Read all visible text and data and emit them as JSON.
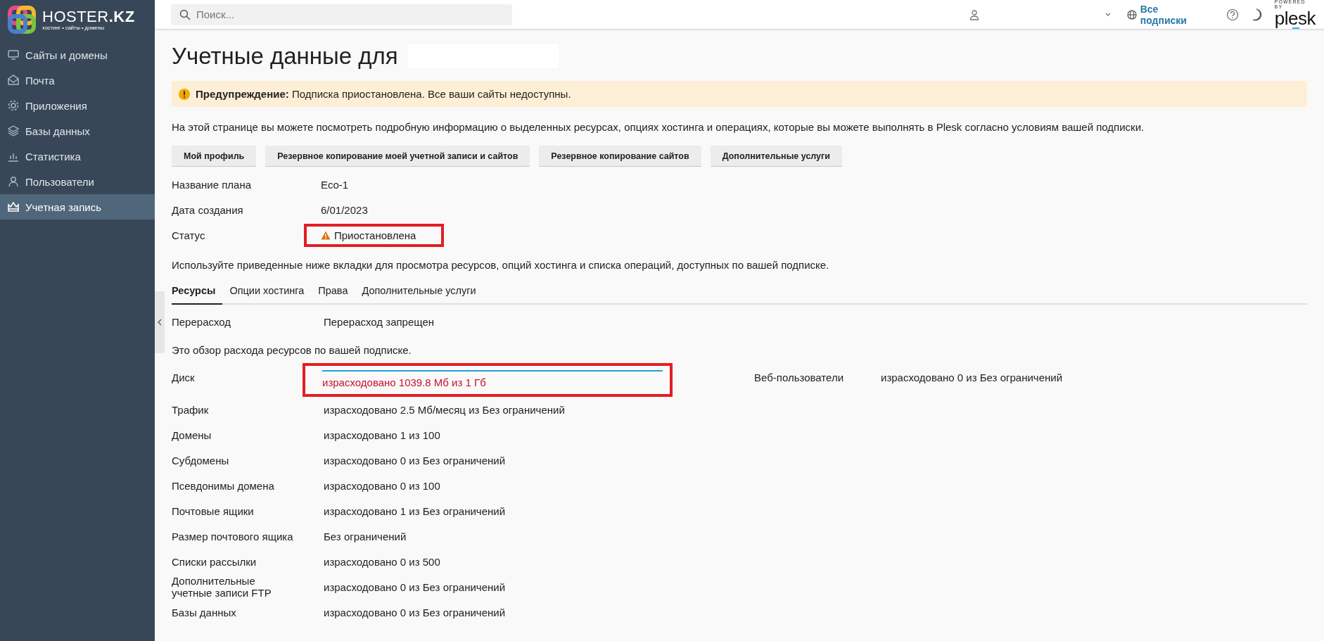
{
  "logo": {
    "brand": "HOSTER",
    "suffix": ".KZ",
    "tagline": "хостинг • сайты • домены"
  },
  "sidebar": {
    "items": [
      {
        "label": "Сайты и домены",
        "selected": false
      },
      {
        "label": "Почта",
        "selected": false
      },
      {
        "label": "Приложения",
        "selected": false
      },
      {
        "label": "Базы данных",
        "selected": false
      },
      {
        "label": "Статистика",
        "selected": false
      },
      {
        "label": "Пользователи",
        "selected": false
      },
      {
        "label": "Учетная запись",
        "selected": true
      }
    ]
  },
  "topbar": {
    "search": {
      "placeholder": "Поиск..."
    },
    "subscriptions_link": "Все подписки",
    "powered_by": "POWERED BY",
    "plesk": "plesk"
  },
  "page": {
    "title": "Учетные данные для",
    "warning": "**Предупреждение:** Подписка приостановлена. Все ваши сайты недоступны.",
    "intro": "На этой странице вы можете посмотреть подробную информацию о выделенных ресурсах, опциях хостинга и операциях, которые вы можете выполнять в Plesk согласно условиям вашей подписки.",
    "buttons": [
      "Мой профиль",
      "Резервное копирование моей учетной записи и сайтов",
      "Резервное копирование сайтов",
      "Дополнительные услуги"
    ],
    "details": [
      {
        "label": "Название плана",
        "value": "Eco-1",
        "warning": false,
        "highlighted": false
      },
      {
        "label": "Дата создания",
        "value": "6/01/2023",
        "warning": false,
        "highlighted": false
      },
      {
        "label": "Статус",
        "value": "Приостановлена",
        "warning": true,
        "highlighted": true
      }
    ],
    "tabs_intro": "Используйте приведенные ниже вкладки для просмотра ресурсов, опций хостинга и списка операций, доступных по вашей подписке.",
    "tabs": [
      {
        "label": "Ресурсы",
        "selected": true
      },
      {
        "label": "Опции хостинга",
        "selected": false
      },
      {
        "label": "Права",
        "selected": false
      },
      {
        "label": "Дополнительные услуги",
        "selected": false
      }
    ],
    "overuse": {
      "label": "Перерасход",
      "value": "Перерасход запрещен"
    },
    "overview": "Это обзор расхода ресурсов по вашей подписке.",
    "resources": [
      {
        "label": "Диск",
        "value": "израсходовано 1039.8 Мб из 1 Гб",
        "kind": "meter",
        "level": 1,
        "over_limit": true,
        "highlighted": true
      },
      {
        "label": "Трафик",
        "value": "израсходовано 2.5 Мб/месяц из Без ограничений",
        "kind": "text",
        "over_limit": false,
        "highlighted": false
      },
      {
        "label": "Домены",
        "value": "израсходовано 1 из 100",
        "kind": "text",
        "over_limit": false,
        "highlighted": false
      },
      {
        "label": "Субдомены",
        "value": "израсходовано 0 из Без ограничений",
        "kind": "text",
        "over_limit": false,
        "highlighted": false
      },
      {
        "label": "Псевдонимы домена",
        "value": "израсходовано 0 из 100",
        "kind": "text",
        "over_limit": false,
        "highlighted": false
      },
      {
        "label": "Почтовые ящики",
        "value": "израсходовано 1 из Без ограничений",
        "kind": "text",
        "over_limit": false,
        "highlighted": false
      },
      {
        "label": "Размер почтового ящика",
        "value": "Без ограничений",
        "kind": "text",
        "over_limit": false,
        "highlighted": false
      },
      {
        "label": "Списки рассылки",
        "value": "израсходовано 0 из 500",
        "kind": "text",
        "over_limit": false,
        "highlighted": false
      },
      {
        "label": "Дополнительные учетные записи FTP",
        "value": "израсходовано 0 из Без ограничений",
        "kind": "text",
        "over_limit": false,
        "highlighted": false
      },
      {
        "label": "Базы данных",
        "value": "израсходовано 0 из Без ограничений",
        "kind": "text",
        "over_limit": false,
        "highlighted": false
      }
    ],
    "resources_side": [
      {
        "label": "Веб-пользователи",
        "value": "израсходовано 0 из Без ограничений"
      }
    ]
  }
}
